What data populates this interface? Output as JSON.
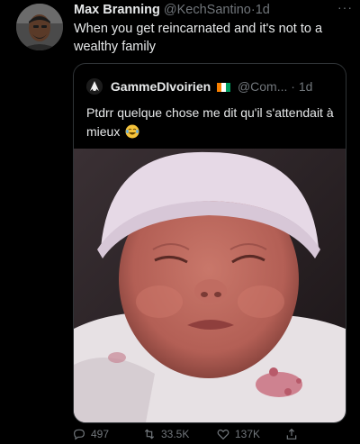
{
  "tweet": {
    "author_name": "Max Branning",
    "author_handle": "@KechSantino",
    "separator": "·",
    "time": "1d",
    "more_label": "···",
    "text": "When you get reincarnated and it's not to a wealthy family",
    "avatar_icon": "user-avatar"
  },
  "quoted_tweet": {
    "author_name": "GammeDIvoirien",
    "flag": "ivory-coast-flag",
    "author_handle": "@Com...",
    "separator": "·",
    "time": "1d",
    "text": "Ptdrr quelque chose me dit qu'il s'attendait à mieux",
    "emoji": "crying-laughing-face",
    "image": "newborn-baby-photo"
  },
  "actions": {
    "replies": "497",
    "retweets": "33.5K",
    "likes": "137K",
    "share_icon": "share-icon"
  },
  "colors": {
    "background": "#000000",
    "text": "#e7e9ea",
    "muted": "#71767b",
    "border": "#2f3336"
  }
}
